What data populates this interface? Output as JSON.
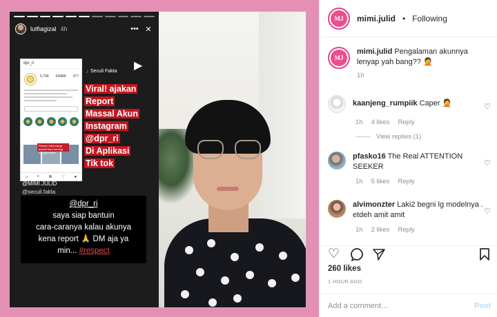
{
  "story": {
    "username": "lutfiagizal",
    "time": "4h",
    "source_label": "Seculi Fakta",
    "headline": [
      "Viral! ajakan",
      "Report",
      "Massal Akun",
      "Instagram",
      "@dpr_ri",
      "Di Aplikasi",
      "Tik tok"
    ],
    "mention1": "@MIMI.JULID",
    "mention2": "@secuil.fakta",
    "msg_handle": "@dpr_ri",
    "msg_line1": "saya siap bantuin",
    "msg_line2": "cara-caranya kalau akunya",
    "msg_line3": "kena report 🙏 DM aja ya",
    "msg_line4": "min...",
    "msg_tag": "#respect",
    "more_icon": "more-dots-icon",
    "close_icon": "close-icon",
    "play_icon": "play-icon"
  },
  "screenshot": {
    "handle": "dpr_ri",
    "stats": [
      "5.799",
      "549RB",
      "377"
    ],
    "stat_labels": [
      "Postingan",
      "Pengikut",
      "Mengikuti"
    ],
    "red_banner": "Relaxin total warga panitia baru kenang menghentikan"
  },
  "header": {
    "logo_text": "MJ",
    "username": "mimi.julid",
    "dot": "•",
    "following": "Following"
  },
  "comments": [
    {
      "user": "mimi.julid",
      "text": "Pengalaman akunnya lenyap yah bang?? 🤦",
      "time": "1h"
    },
    {
      "user": "kaanjeng_rumpiik",
      "text": "Caper 🤦",
      "time": "1h",
      "likes": "4 likes",
      "reply": "Reply",
      "view_replies": "View replies (1)"
    },
    {
      "user": "pfasko16",
      "text": "The Real ATTENTION SEEKER",
      "time": "1h",
      "likes": "5 likes",
      "reply": "Reply"
    },
    {
      "user": "alvimonzter",
      "text": "Laki2 begni lg modelnya . etdeh amit amit",
      "time": "1h",
      "likes": "2 likes",
      "reply": "Reply"
    }
  ],
  "actions": {
    "like_icon": "heart-icon",
    "comment_icon": "comment-icon",
    "share_icon": "share-icon",
    "save_icon": "bookmark-icon"
  },
  "likes": "260 likes",
  "time_ago": "1 HOUR AGO",
  "add_comment": {
    "placeholder": "Add a comment…",
    "post_label": "Post"
  },
  "colors": {
    "frame": "#e48fb4",
    "brand_pink": "#e84f8f",
    "headline_red": "#c3161f",
    "post_disabled": "#b2dffc"
  }
}
